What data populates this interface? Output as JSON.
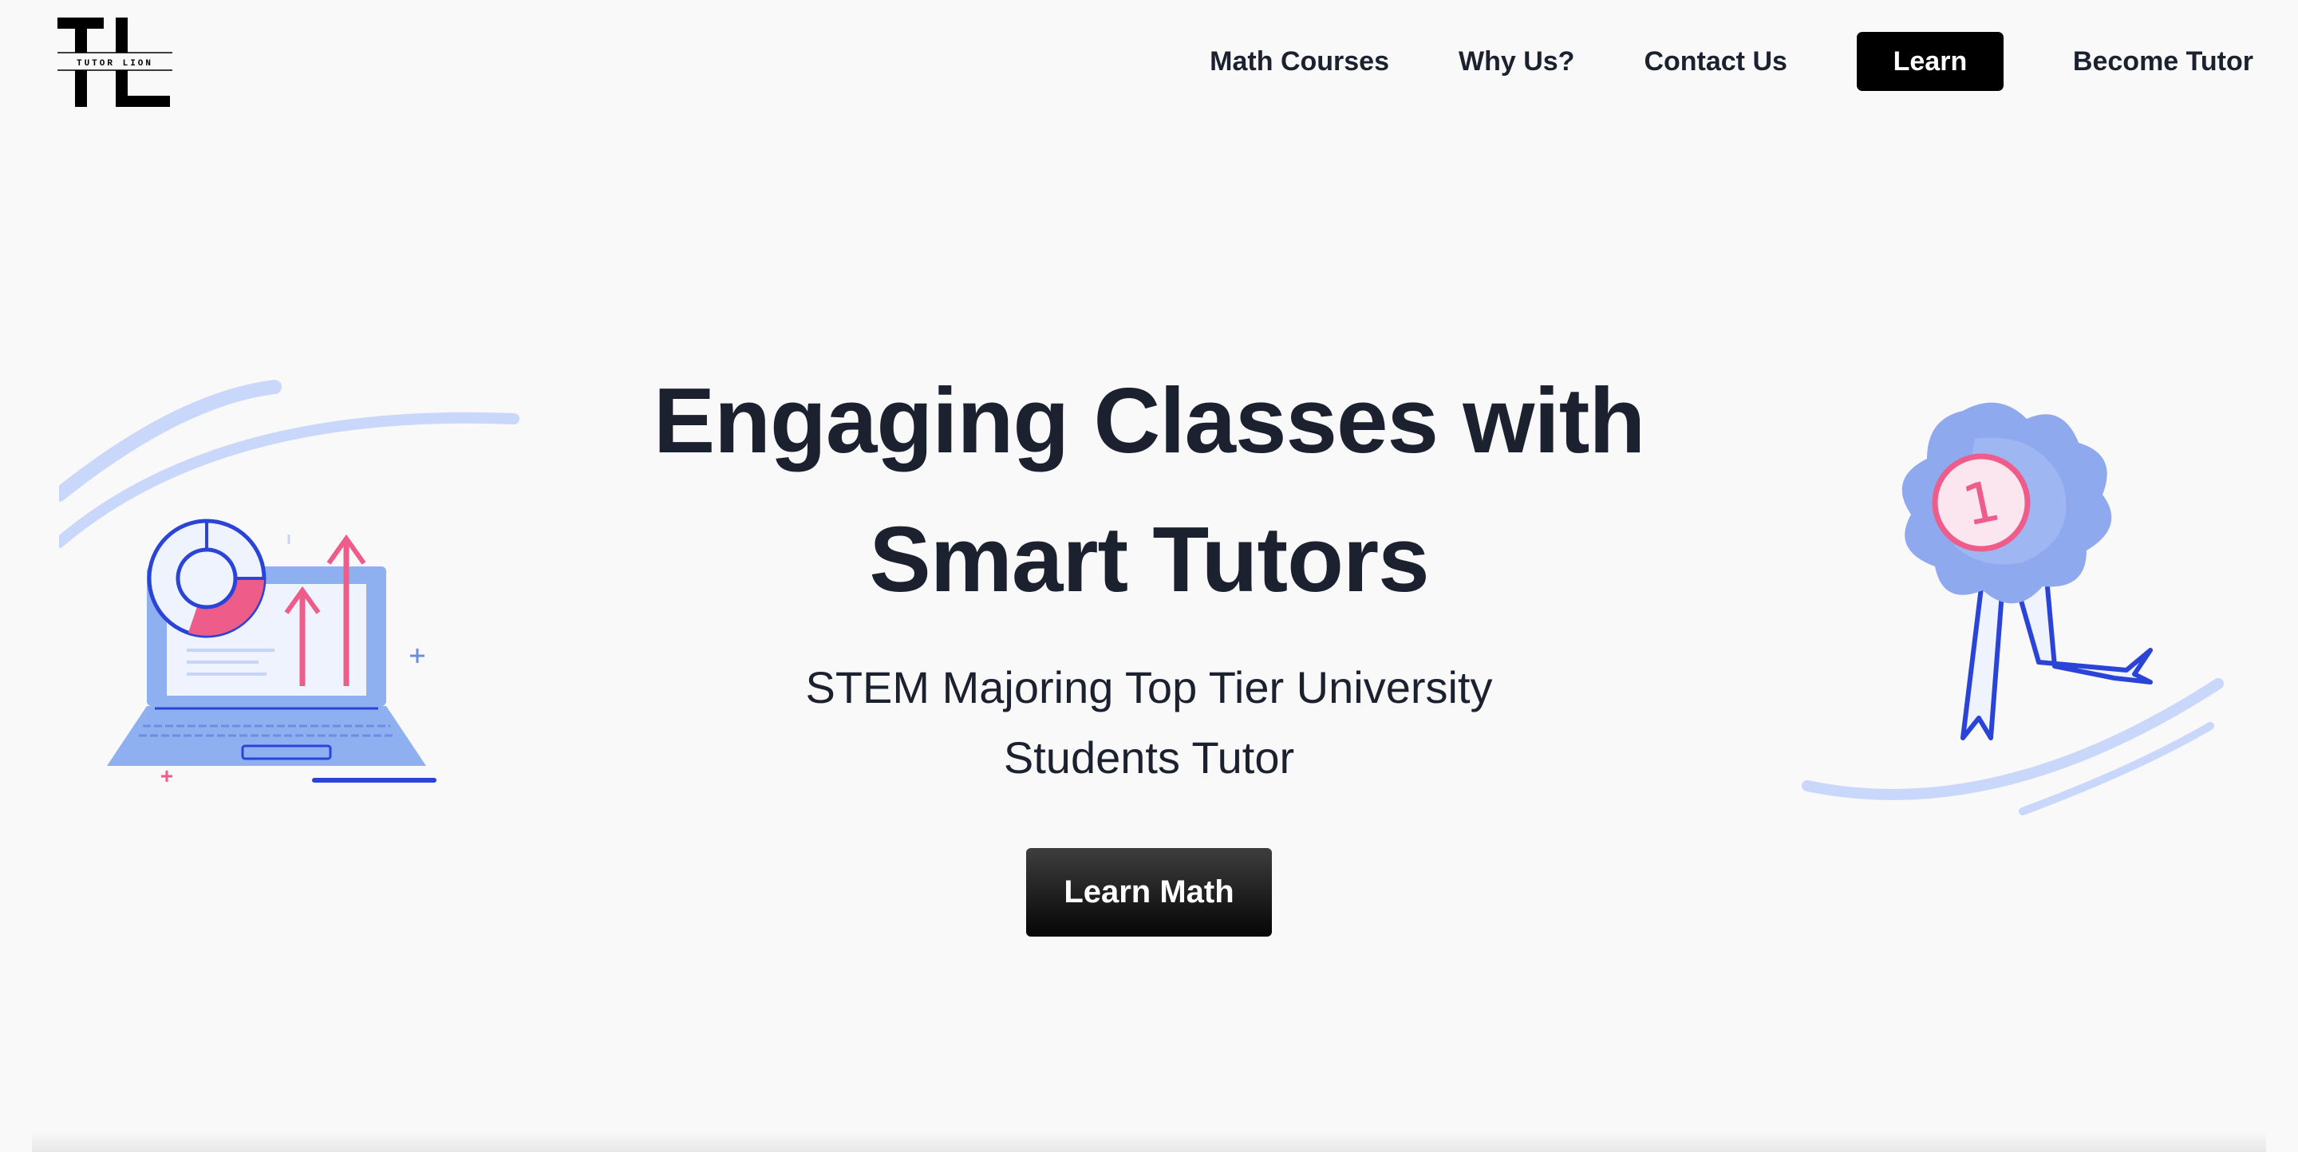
{
  "brand": {
    "logo_mark": "TL",
    "logo_text": "TUTOR LION"
  },
  "nav": {
    "math_courses": "Math Courses",
    "why_us": "Why Us?",
    "contact_us": "Contact Us",
    "learn": "Learn",
    "become_tutor": "Become Tutor"
  },
  "hero": {
    "title_line1": "Engaging Classes with",
    "title_line2": "Smart Tutors",
    "subtitle_line1": "STEM Majoring Top Tier University",
    "subtitle_line2": "Students Tutor",
    "cta": "Learn Math"
  },
  "badge": {
    "number": "1"
  },
  "colors": {
    "background": "#f9f9fa",
    "text": "#1c2130",
    "button": "#000000",
    "illustration_blue": "#7fa2ec",
    "illustration_dark_blue": "#2a44d8",
    "illustration_pink": "#ee5c8a"
  },
  "icons": {
    "logo": "tutor-lion-logo",
    "left_illustration": "laptop-chart-illustration",
    "right_illustration": "award-ribbon-illustration"
  }
}
